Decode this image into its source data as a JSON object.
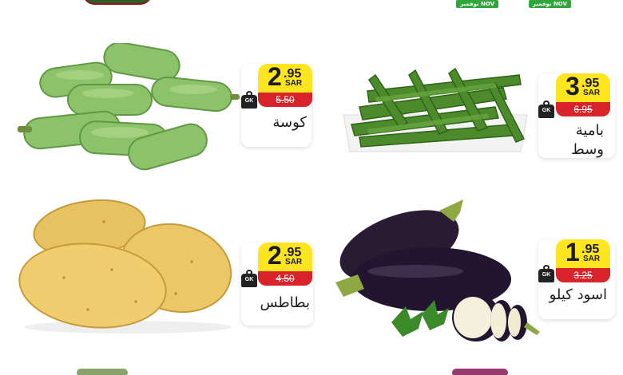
{
  "header": {
    "date_badge_1": "نوفمبر NOV",
    "date_badge_2": "نوفمبر NOV"
  },
  "products": [
    {
      "name": "كوسة",
      "price_int": "2",
      "price_dec": ".95",
      "currency": "SAR",
      "old_price": "5.50",
      "unit_icon": "GK"
    },
    {
      "name_line1": "بامية",
      "name_line2": "وسط",
      "price_int": "3",
      "price_dec": ".95",
      "currency": "SAR",
      "old_price": "6.95",
      "unit_icon": "GK"
    },
    {
      "name": "بطاطس",
      "price_int": "2",
      "price_dec": ".95",
      "currency": "SAR",
      "old_price": "4.50",
      "unit_icon": "GK"
    },
    {
      "name": "اسود كيلو",
      "price_int": "1",
      "price_dec": ".95",
      "currency": "SAR",
      "old_price": "3.25",
      "unit_icon": "GK"
    }
  ],
  "colors": {
    "price_yellow": "#ffe51f",
    "old_price_red": "#d9232a",
    "badge_green": "#2fa53a"
  }
}
